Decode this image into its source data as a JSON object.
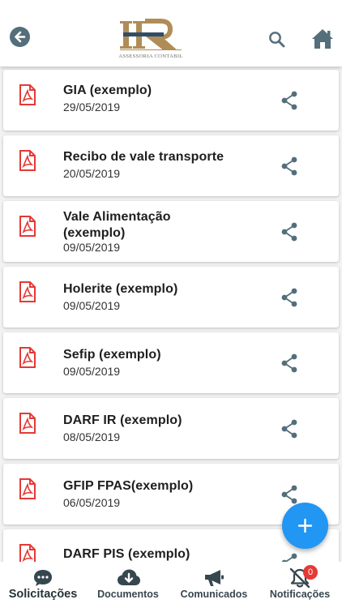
{
  "header": {
    "logo_text": "ASSESSORIA CONTABIL",
    "back_icon": "arrow-left-icon",
    "search_icon": "search-icon",
    "home_icon": "home-icon"
  },
  "documents": [
    {
      "title": "GIA (exemplo)",
      "date": "29/05/2019"
    },
    {
      "title": "Recibo de vale transporte",
      "date": "20/05/2019"
    },
    {
      "title": "Vale Alimentação (exemplo)",
      "date": "09/05/2019"
    },
    {
      "title": "Holerite (exemplo)",
      "date": "09/05/2019"
    },
    {
      "title": "Sefip (exemplo)",
      "date": "09/05/2019"
    },
    {
      "title": "DARF IR (exemplo)",
      "date": "08/05/2019"
    },
    {
      "title": "GFIP FPAS(exemplo)",
      "date": "06/05/2019"
    },
    {
      "title": "DARF PIS (exemplo)",
      "date": ""
    }
  ],
  "fab": {
    "icon": "plus-icon"
  },
  "bottom_nav": {
    "items": [
      {
        "label": "Solicitações",
        "icon": "chat-icon"
      },
      {
        "label": "Documentos",
        "icon": "cloud-download-icon"
      },
      {
        "label": "Comunicados",
        "icon": "megaphone-icon"
      },
      {
        "label": "Notificações",
        "icon": "bell-off-icon"
      }
    ],
    "notifications_badge": "0"
  },
  "colors": {
    "accent": "#2196f3",
    "pdf_red": "#e53935",
    "icon_gray": "#546e7a",
    "logo_gold": "#b08d57"
  }
}
